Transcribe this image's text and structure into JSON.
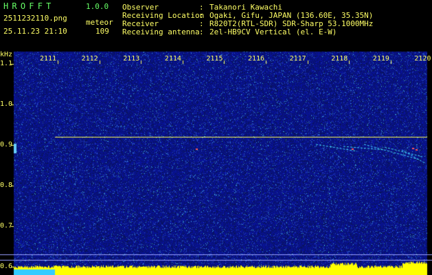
{
  "header": {
    "app_name": "HROFFT",
    "app_version": "1.0.0",
    "file_name": "2511232110.png",
    "meteor_label": "meteor",
    "timestamp": "25.11.23 21:10",
    "meteor_count": "109",
    "info": [
      {
        "label": "Observer",
        "value": "Takanori Kawachi"
      },
      {
        "label": "Receiving Location",
        "value": "Ogaki, Gifu, JAPAN (136.60E, 35.35N)"
      },
      {
        "label": "Receiver",
        "value": "R820T2(RTL-SDR) SDR-Sharp 53.1000MHz"
      },
      {
        "label": "Receiving antenna",
        "value": "2el-HB9CV Vertical (el. E-W)"
      }
    ]
  },
  "colors": {
    "header_text": "#ffff66",
    "title_text": "#66ff66",
    "background_noise": "#101a8a",
    "carrier": "#ffff55",
    "bottom_bar": "#ffff00"
  },
  "chart_data": {
    "type": "heatmap",
    "yunit": "kHz",
    "x_ticks": [
      "2111",
      "2112",
      "2113",
      "2114",
      "2115",
      "2116",
      "2117",
      "2118",
      "2119",
      "2120"
    ],
    "y_ticks": [
      "1.1",
      "1.0",
      "0.9",
      "0.8",
      "0.7",
      "0.6"
    ],
    "carrier_khz": 0.92
  }
}
